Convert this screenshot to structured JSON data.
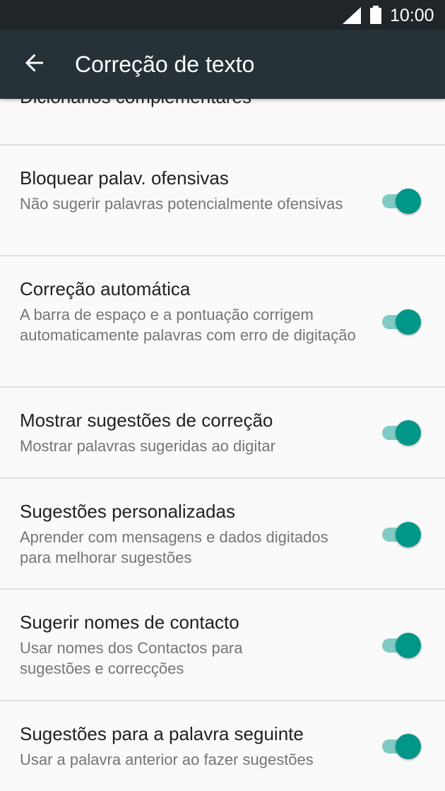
{
  "status_bar": {
    "time": "10:00",
    "icons": [
      "signal-icon",
      "battery-icon"
    ]
  },
  "toolbar": {
    "back_icon": "arrow-left-icon",
    "title": "Correção de texto"
  },
  "colors": {
    "status_bar": "#1f2529",
    "toolbar": "#263238",
    "switch_on_thumb": "#009688",
    "switch_on_track": "#80cbc4",
    "background": "#fafafa",
    "divider": "#e0e0e0"
  },
  "settings": [
    {
      "title": "Dicionários complementares",
      "summary": ""
    },
    {
      "title": "Bloquear palav. ofensivas",
      "summary": "Não sugerir palavras potencialmente ofensivas",
      "enabled": true
    },
    {
      "title": "Correção automática",
      "summary": "A barra de espaço e a pontuação corrigem automaticamente palavras com erro de digitação",
      "enabled": true
    },
    {
      "title": "Mostrar sugestões de correção",
      "summary": "Mostrar palavras sugeridas ao digitar",
      "enabled": true
    },
    {
      "title": "Sugestões personalizadas",
      "summary": "Aprender com mensagens e dados digitados para melhorar sugestões",
      "enabled": true
    },
    {
      "title": "Sugerir nomes de contacto",
      "summary": "Usar nomes dos Contactos para sugestões e correcções",
      "enabled": true
    },
    {
      "title": "Sugestões para a palavra seguinte",
      "summary": "Usar a palavra anterior ao fazer sugestões",
      "enabled": true
    }
  ]
}
